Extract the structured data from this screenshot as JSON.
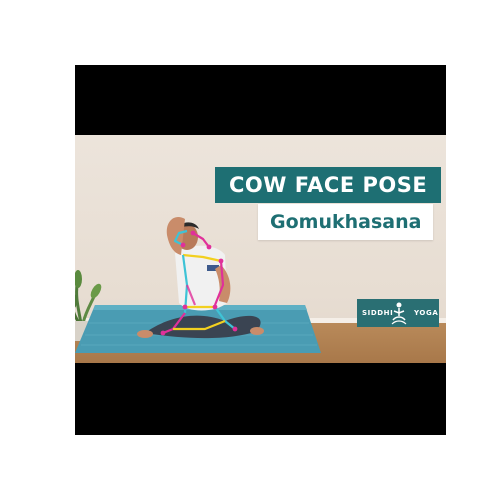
{
  "video": {
    "title": "COW FACE POSE",
    "subtitle": "Gomukhasana",
    "logo": {
      "left": "SIDDHI",
      "right": "YOGA"
    }
  },
  "colors": {
    "letterbox": "#000000",
    "wall": "#e7ddd2",
    "banner_teal": "#1e6f73",
    "mat": "#4a9cb3",
    "skeleton_magenta": "#e0309a",
    "skeleton_cyan": "#3ec3d6",
    "skeleton_yellow": "#f2d020"
  },
  "icons": [
    "lotus-figure-icon",
    "potted-plant"
  ]
}
